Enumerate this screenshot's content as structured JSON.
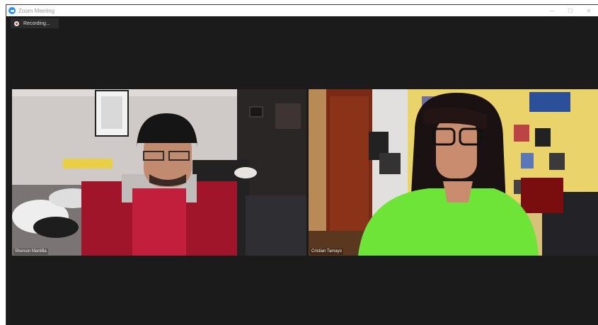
{
  "window": {
    "title": "Zoom Meeting",
    "controls": {
      "minimize": "—",
      "maximize": "☐",
      "close": "✕"
    }
  },
  "recording": {
    "label": "Recording..."
  },
  "participants": [
    {
      "name": "Sherson Mantilla"
    },
    {
      "name": "Cristian Tamayo"
    }
  ],
  "colors": {
    "window_bg": "#1b1b1b",
    "zoom_blue": "#2d8cff"
  }
}
